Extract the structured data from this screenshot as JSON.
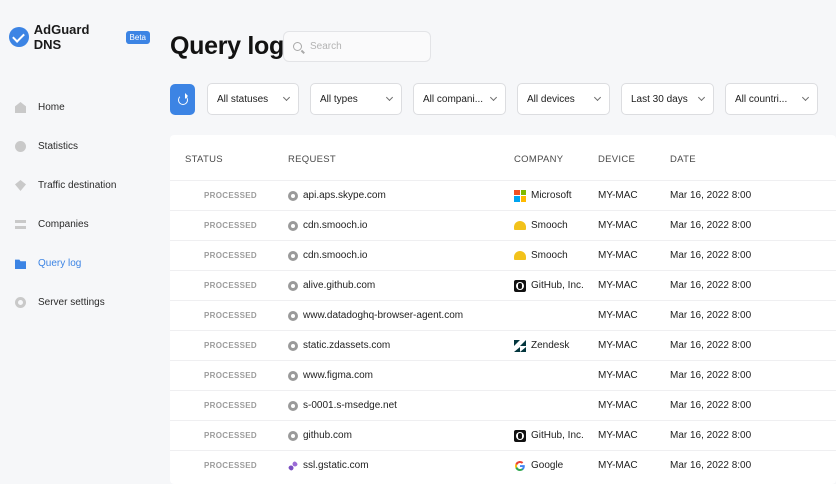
{
  "brand": {
    "name": "AdGuard DNS",
    "badge": "Beta",
    "accent": "#3c84e4"
  },
  "sidebar": {
    "items": [
      {
        "label": "Home",
        "icon": "home-icon",
        "active": false
      },
      {
        "label": "Statistics",
        "icon": "statistics-icon",
        "active": false
      },
      {
        "label": "Traffic destination",
        "icon": "traffic-destination-icon",
        "active": false
      },
      {
        "label": "Companies",
        "icon": "companies-icon",
        "active": false
      },
      {
        "label": "Query log",
        "icon": "query-log-icon",
        "active": true
      },
      {
        "label": "Server settings",
        "icon": "server-settings-icon",
        "active": false
      }
    ]
  },
  "header": {
    "title": "Query log",
    "search_placeholder": "Search"
  },
  "filters": [
    {
      "label": "All statuses"
    },
    {
      "label": "All types"
    },
    {
      "label": "All compani..."
    },
    {
      "label": "All devices"
    },
    {
      "label": "Last 30 days"
    },
    {
      "label": "All countri..."
    }
  ],
  "table": {
    "columns": [
      "STATUS",
      "REQUEST",
      "COMPANY",
      "DEVICE",
      "DATE"
    ],
    "rows": [
      {
        "status": "PROCESSED",
        "request": "api.aps.skype.com",
        "company": "Microsoft",
        "company_icon": "microsoft",
        "device": "MY-MAC",
        "date": "Mar 16, 2022 8:00"
      },
      {
        "status": "PROCESSED",
        "request": "cdn.smooch.io",
        "company": "Smooch",
        "company_icon": "smooch",
        "device": "MY-MAC",
        "date": "Mar 16, 2022 8:00"
      },
      {
        "status": "PROCESSED",
        "request": "cdn.smooch.io",
        "company": "Smooch",
        "company_icon": "smooch",
        "device": "MY-MAC",
        "date": "Mar 16, 2022 8:00"
      },
      {
        "status": "PROCESSED",
        "request": "alive.github.com",
        "company": "GitHub, Inc.",
        "company_icon": "github",
        "device": "MY-MAC",
        "date": "Mar 16, 2022 8:00"
      },
      {
        "status": "PROCESSED",
        "request": "www.datadoghq-browser-agent.com",
        "company": "",
        "company_icon": "",
        "device": "MY-MAC",
        "date": "Mar 16, 2022 8:00"
      },
      {
        "status": "PROCESSED",
        "request": "static.zdassets.com",
        "company": "Zendesk",
        "company_icon": "zendesk",
        "device": "MY-MAC",
        "date": "Mar 16, 2022 8:00"
      },
      {
        "status": "PROCESSED",
        "request": "www.figma.com",
        "company": "",
        "company_icon": "",
        "device": "MY-MAC",
        "date": "Mar 16, 2022 8:00"
      },
      {
        "status": "PROCESSED",
        "request": "s-0001.s-msedge.net",
        "company": "",
        "company_icon": "",
        "device": "MY-MAC",
        "date": "Mar 16, 2022 8:00"
      },
      {
        "status": "PROCESSED",
        "request": "github.com",
        "company": "GitHub, Inc.",
        "company_icon": "github",
        "device": "MY-MAC",
        "date": "Mar 16, 2022 8:00"
      },
      {
        "status": "PROCESSED",
        "request": "ssl.gstatic.com",
        "company": "Google",
        "company_icon": "google",
        "device": "MY-MAC",
        "date": "Mar 16, 2022 8:00"
      }
    ]
  }
}
